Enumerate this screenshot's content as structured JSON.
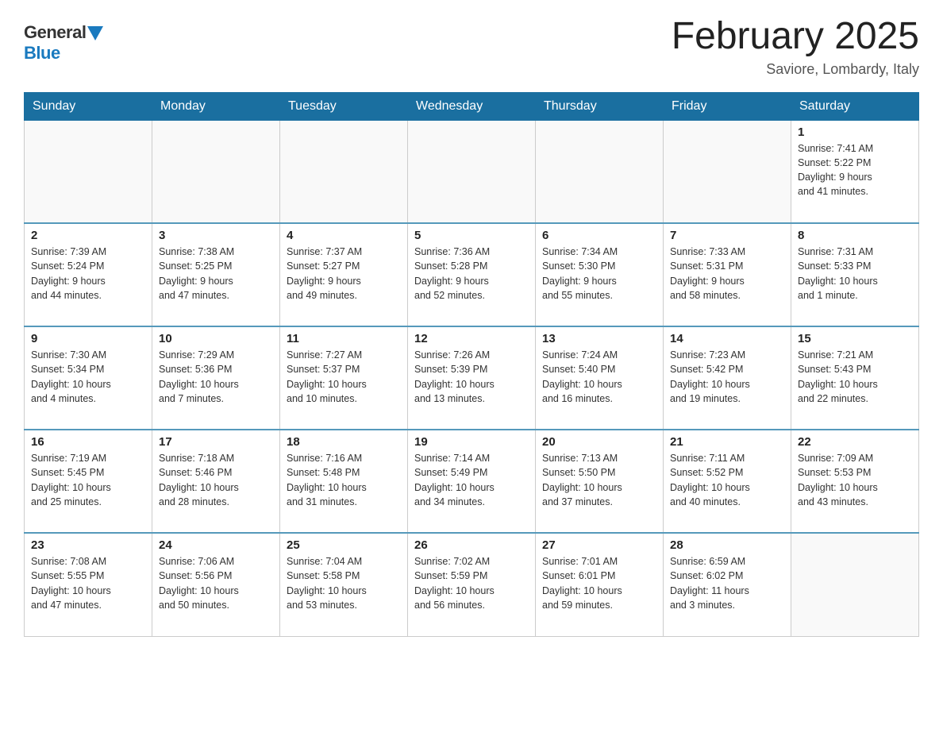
{
  "header": {
    "logo_general": "General",
    "logo_blue": "Blue",
    "month_title": "February 2025",
    "location": "Saviore, Lombardy, Italy"
  },
  "weekdays": [
    "Sunday",
    "Monday",
    "Tuesday",
    "Wednesday",
    "Thursday",
    "Friday",
    "Saturday"
  ],
  "weeks": [
    [
      {
        "day": "",
        "info": ""
      },
      {
        "day": "",
        "info": ""
      },
      {
        "day": "",
        "info": ""
      },
      {
        "day": "",
        "info": ""
      },
      {
        "day": "",
        "info": ""
      },
      {
        "day": "",
        "info": ""
      },
      {
        "day": "1",
        "info": "Sunrise: 7:41 AM\nSunset: 5:22 PM\nDaylight: 9 hours\nand 41 minutes."
      }
    ],
    [
      {
        "day": "2",
        "info": "Sunrise: 7:39 AM\nSunset: 5:24 PM\nDaylight: 9 hours\nand 44 minutes."
      },
      {
        "day": "3",
        "info": "Sunrise: 7:38 AM\nSunset: 5:25 PM\nDaylight: 9 hours\nand 47 minutes."
      },
      {
        "day": "4",
        "info": "Sunrise: 7:37 AM\nSunset: 5:27 PM\nDaylight: 9 hours\nand 49 minutes."
      },
      {
        "day": "5",
        "info": "Sunrise: 7:36 AM\nSunset: 5:28 PM\nDaylight: 9 hours\nand 52 minutes."
      },
      {
        "day": "6",
        "info": "Sunrise: 7:34 AM\nSunset: 5:30 PM\nDaylight: 9 hours\nand 55 minutes."
      },
      {
        "day": "7",
        "info": "Sunrise: 7:33 AM\nSunset: 5:31 PM\nDaylight: 9 hours\nand 58 minutes."
      },
      {
        "day": "8",
        "info": "Sunrise: 7:31 AM\nSunset: 5:33 PM\nDaylight: 10 hours\nand 1 minute."
      }
    ],
    [
      {
        "day": "9",
        "info": "Sunrise: 7:30 AM\nSunset: 5:34 PM\nDaylight: 10 hours\nand 4 minutes."
      },
      {
        "day": "10",
        "info": "Sunrise: 7:29 AM\nSunset: 5:36 PM\nDaylight: 10 hours\nand 7 minutes."
      },
      {
        "day": "11",
        "info": "Sunrise: 7:27 AM\nSunset: 5:37 PM\nDaylight: 10 hours\nand 10 minutes."
      },
      {
        "day": "12",
        "info": "Sunrise: 7:26 AM\nSunset: 5:39 PM\nDaylight: 10 hours\nand 13 minutes."
      },
      {
        "day": "13",
        "info": "Sunrise: 7:24 AM\nSunset: 5:40 PM\nDaylight: 10 hours\nand 16 minutes."
      },
      {
        "day": "14",
        "info": "Sunrise: 7:23 AM\nSunset: 5:42 PM\nDaylight: 10 hours\nand 19 minutes."
      },
      {
        "day": "15",
        "info": "Sunrise: 7:21 AM\nSunset: 5:43 PM\nDaylight: 10 hours\nand 22 minutes."
      }
    ],
    [
      {
        "day": "16",
        "info": "Sunrise: 7:19 AM\nSunset: 5:45 PM\nDaylight: 10 hours\nand 25 minutes."
      },
      {
        "day": "17",
        "info": "Sunrise: 7:18 AM\nSunset: 5:46 PM\nDaylight: 10 hours\nand 28 minutes."
      },
      {
        "day": "18",
        "info": "Sunrise: 7:16 AM\nSunset: 5:48 PM\nDaylight: 10 hours\nand 31 minutes."
      },
      {
        "day": "19",
        "info": "Sunrise: 7:14 AM\nSunset: 5:49 PM\nDaylight: 10 hours\nand 34 minutes."
      },
      {
        "day": "20",
        "info": "Sunrise: 7:13 AM\nSunset: 5:50 PM\nDaylight: 10 hours\nand 37 minutes."
      },
      {
        "day": "21",
        "info": "Sunrise: 7:11 AM\nSunset: 5:52 PM\nDaylight: 10 hours\nand 40 minutes."
      },
      {
        "day": "22",
        "info": "Sunrise: 7:09 AM\nSunset: 5:53 PM\nDaylight: 10 hours\nand 43 minutes."
      }
    ],
    [
      {
        "day": "23",
        "info": "Sunrise: 7:08 AM\nSunset: 5:55 PM\nDaylight: 10 hours\nand 47 minutes."
      },
      {
        "day": "24",
        "info": "Sunrise: 7:06 AM\nSunset: 5:56 PM\nDaylight: 10 hours\nand 50 minutes."
      },
      {
        "day": "25",
        "info": "Sunrise: 7:04 AM\nSunset: 5:58 PM\nDaylight: 10 hours\nand 53 minutes."
      },
      {
        "day": "26",
        "info": "Sunrise: 7:02 AM\nSunset: 5:59 PM\nDaylight: 10 hours\nand 56 minutes."
      },
      {
        "day": "27",
        "info": "Sunrise: 7:01 AM\nSunset: 6:01 PM\nDaylight: 10 hours\nand 59 minutes."
      },
      {
        "day": "28",
        "info": "Sunrise: 6:59 AM\nSunset: 6:02 PM\nDaylight: 11 hours\nand 3 minutes."
      },
      {
        "day": "",
        "info": ""
      }
    ]
  ]
}
